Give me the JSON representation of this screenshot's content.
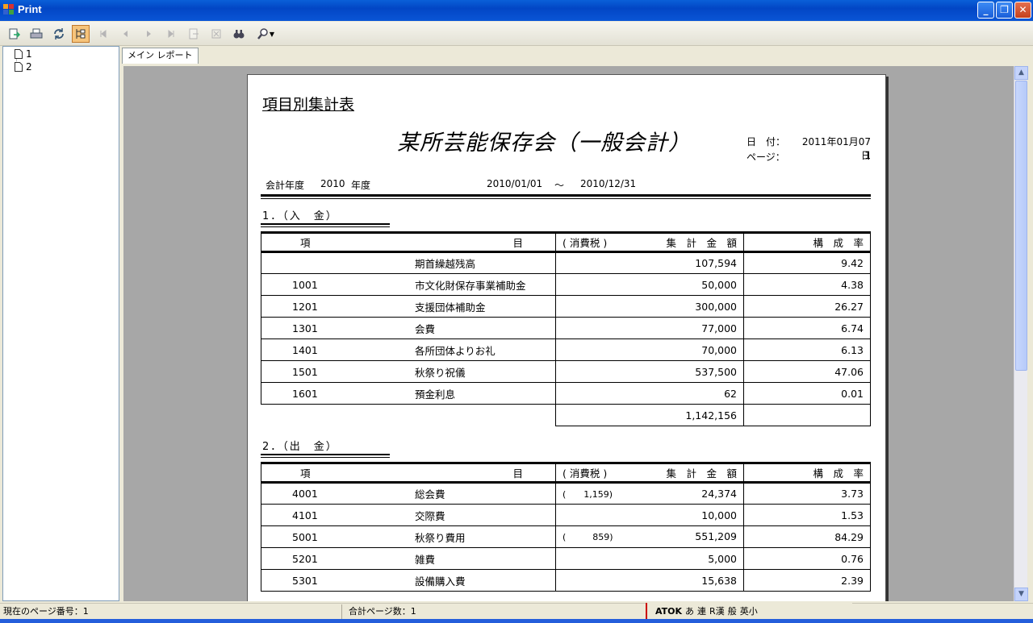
{
  "window": {
    "title": "Print"
  },
  "toolbar": {
    "icons": [
      "export-icon",
      "print-icon",
      "refresh-icon",
      "toggle-tree-icon",
      "first-page-icon",
      "prev-page-icon",
      "next-page-icon",
      "last-page-icon",
      "goto-page-icon",
      "stop-icon",
      "find-icon",
      "zoom-icon"
    ]
  },
  "tree": {
    "items": [
      "1",
      "2"
    ]
  },
  "tab": {
    "label": "メイン レポート"
  },
  "report": {
    "title": "項目別集計表",
    "org": "某所芸能保存会（一般会計）",
    "date_label": "日　付：",
    "date_value": "2011年01月07日",
    "page_label": "ページ：",
    "page_value": "1",
    "fiscal_label": "会計年度",
    "fiscal_year": "2010",
    "fiscal_suffix": "年度",
    "period_start": "2010/01/01",
    "period_sep": "～",
    "period_end": "2010/12/31",
    "headers": {
      "item_a": "項",
      "item_b": "目",
      "tax": "( 消費税 )",
      "amount": "集　計　金　額",
      "rate": "構　成　率"
    },
    "income": {
      "heading": "1．（入　金）",
      "rows": [
        {
          "code": "",
          "name": "期首繰越残高",
          "tax": "",
          "amount": "107,594",
          "rate": "9.42"
        },
        {
          "code": "1001",
          "name": "市文化財保存事業補助金",
          "tax": "",
          "amount": "50,000",
          "rate": "4.38"
        },
        {
          "code": "1201",
          "name": "支援団体補助金",
          "tax": "",
          "amount": "300,000",
          "rate": "26.27"
        },
        {
          "code": "1301",
          "name": "会費",
          "tax": "",
          "amount": "77,000",
          "rate": "6.74"
        },
        {
          "code": "1401",
          "name": "各所団体よりお礼",
          "tax": "",
          "amount": "70,000",
          "rate": "6.13"
        },
        {
          "code": "1501",
          "name": "秋祭り祝儀",
          "tax": "",
          "amount": "537,500",
          "rate": "47.06"
        },
        {
          "code": "1601",
          "name": "預金利息",
          "tax": "",
          "amount": "62",
          "rate": "0.01"
        }
      ],
      "total": "1,142,156"
    },
    "expense": {
      "heading": "2．（出　金）",
      "rows": [
        {
          "code": "4001",
          "name": "総会費",
          "tax": "(　　1,159)",
          "amount": "24,374",
          "rate": "3.73"
        },
        {
          "code": "4101",
          "name": "交際費",
          "tax": "",
          "amount": "10,000",
          "rate": "1.53"
        },
        {
          "code": "5001",
          "name": "秋祭り費用",
          "tax": "(　　　859)",
          "amount": "551,209",
          "rate": "84.29"
        },
        {
          "code": "5201",
          "name": "雑費",
          "tax": "",
          "amount": "5,000",
          "rate": "0.76"
        },
        {
          "code": "5301",
          "name": "設備購入費",
          "tax": "",
          "amount": "15,638",
          "rate": "2.39"
        }
      ]
    }
  },
  "status": {
    "current_page": "現在のページ番号：1",
    "total_pages": "合計ページ数：1"
  },
  "ime": {
    "items": [
      "ATOK",
      "あ",
      "連",
      "R漢",
      "般",
      "英小"
    ]
  }
}
